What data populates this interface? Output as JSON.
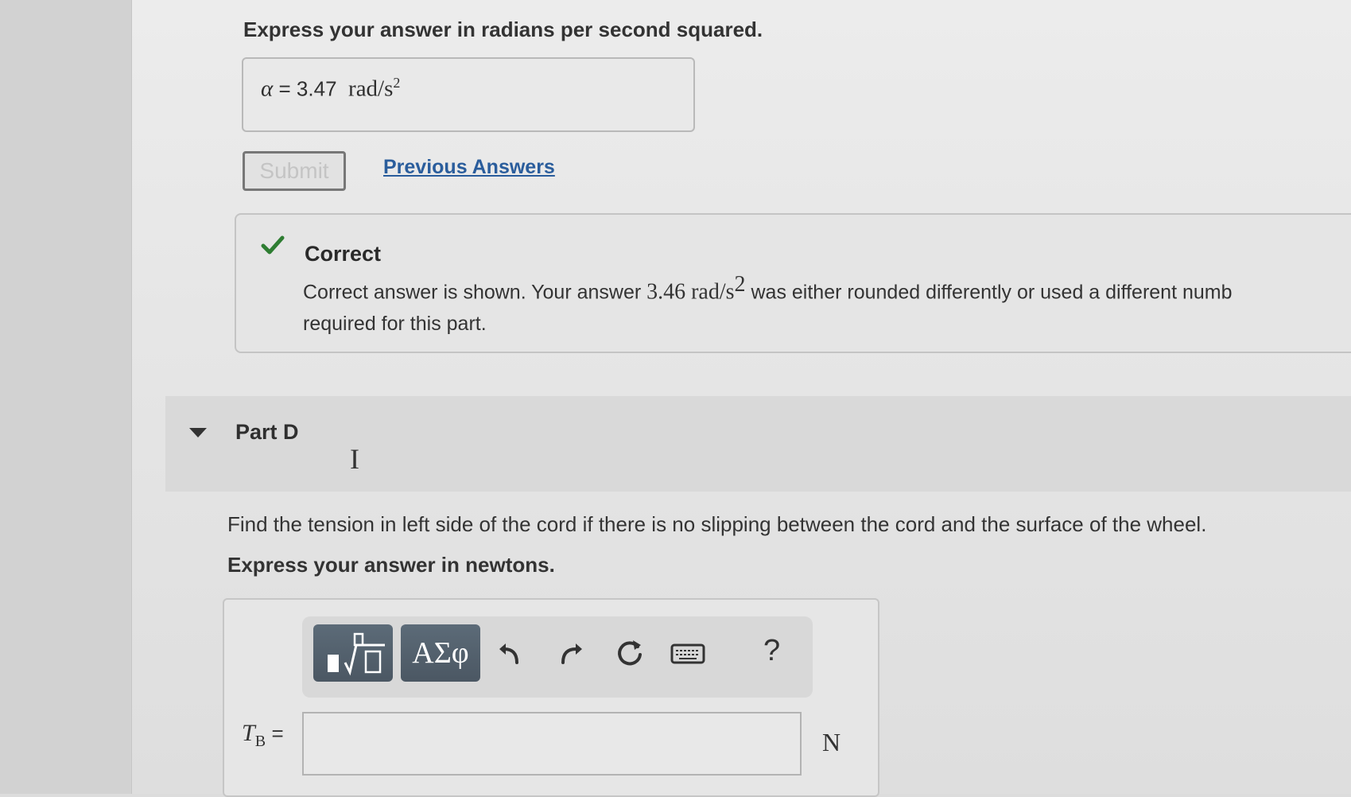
{
  "part_c": {
    "instruction": "Express your answer in radians per second squared.",
    "answer_symbol": "α",
    "answer_eq": "=",
    "answer_value": "3.47",
    "answer_unit": "rad/s",
    "answer_unit_exp": "2",
    "submit_label": "Submit",
    "previous_answers_label": "Previous Answers"
  },
  "feedback": {
    "status": "Correct",
    "text_before": "Correct answer is shown. Your answer",
    "user_answer": "3.46",
    "user_unit": "rad/s",
    "user_unit_exp": "2",
    "text_after": "was either rounded differently or used a different numb",
    "text_line2": "required for this part."
  },
  "part_d": {
    "title": "Part D",
    "question": "Find the tension in left side of the cord if there is no slipping between the cord and the surface of the wheel.",
    "instruction": "Express your answer in newtons.",
    "greek_button_label": "ΑΣφ",
    "help_label": "?",
    "var_symbol": "T",
    "var_subscript": "B",
    "var_eq": "=",
    "unit": "N",
    "input_value": ""
  },
  "icons": {
    "check": "check-icon",
    "caret": "caret-down-icon",
    "templates": "math-templates-icon",
    "undo": "undo-icon",
    "redo": "redo-icon",
    "reset": "reset-icon",
    "keyboard": "keyboard-icon"
  },
  "colors": {
    "check_green": "#2e7d32",
    "link_blue": "#2a5d9c",
    "toolbar_button": "#55626e"
  }
}
